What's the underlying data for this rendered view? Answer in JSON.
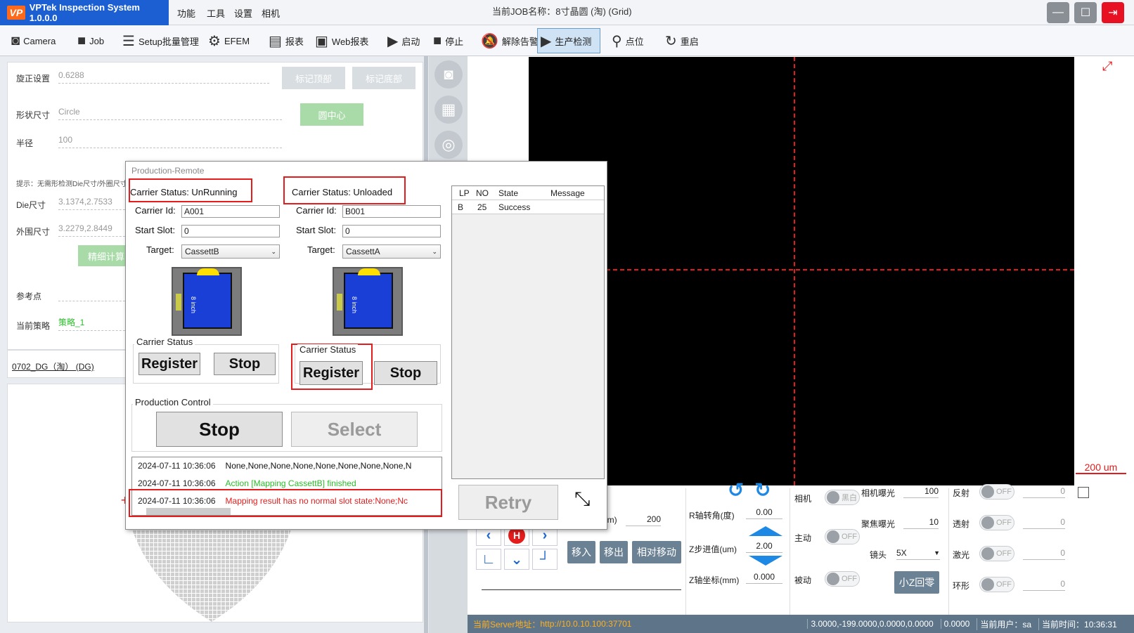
{
  "app": {
    "title": "VPTek Inspection System 1.0.0.0",
    "logo": "VP",
    "job_title": "当前JOB名称：8寸晶圆  (淘)  (Grid)"
  },
  "menu": [
    "功能",
    "工具",
    "设置",
    "相机"
  ],
  "window": {
    "minimize": "—",
    "maximize": "☐",
    "exit": "⇥"
  },
  "toolbar": [
    {
      "label": "Camera",
      "icon": "camera-icon"
    },
    {
      "label": "Job",
      "icon": "briefcase-icon"
    },
    {
      "label": "Setup批量管理",
      "icon": "list-icon"
    },
    {
      "label": "EFEM",
      "icon": "robot-arm-icon"
    },
    {
      "label": "报表",
      "icon": "report-icon"
    },
    {
      "label": "Web报表",
      "icon": "web-report-icon"
    },
    {
      "label": "启动",
      "icon": "play-icon"
    },
    {
      "label": "停止",
      "icon": "stop-icon"
    },
    {
      "label": "解除告警",
      "icon": "bell-off-icon"
    },
    {
      "label": "生产检测",
      "icon": "play-icon"
    },
    {
      "label": "点位",
      "icon": "location-pin-icon"
    },
    {
      "label": "重启",
      "icon": "refresh-icon"
    }
  ],
  "left": {
    "rotation_label": "旋正设置",
    "rotation_value": "0.6288",
    "mark_top": "标记顶部",
    "mark_bottom": "标记底部",
    "shape_label": "形状尺寸",
    "shape_value": "Circle",
    "circle_center": "圆中心",
    "radius_label": "半径",
    "radius_value": "100",
    "hint": "提示：无需形检测Die尺寸/外圈尺寸",
    "die_label": "Die尺寸",
    "die_value": "3.1374,2.7533",
    "outer_label": "外围尺寸",
    "outer_value": "3.2279,2.8449",
    "refine_btn": "精细计算",
    "ref_label": "参考点",
    "strategy_label": "当前策略",
    "strategy_value": "策略_1",
    "job_link": "0702_DG（淘） (DG)"
  },
  "image": {
    "scale": "200 um"
  },
  "bottom": {
    "um_label": "um)",
    "um_value": "200",
    "r_label": "R轴转角(度)",
    "r_value": "0.00",
    "zstep_label": "Z步进值(um)",
    "zstep_value": "2.00",
    "zcoord_label": "Z轴坐标(mm)",
    "zcoord_value": "0.000",
    "move_in": "移入",
    "move_out": "移出",
    "rel_move": "相对移动",
    "camera_label": "相机",
    "camera_toggle": "黑白",
    "active_label": "主动",
    "passive_label": "被动",
    "off": "OFF",
    "cam_exposure_label": "相机曝光",
    "cam_exposure_value": "100",
    "focus_exposure_label": "聚焦曝光",
    "focus_exposure_value": "10",
    "lens_label": "镜头",
    "lens_value": "5X",
    "small_z_home": "小Z回零",
    "reflect_label": "反射",
    "transmit_label": "透射",
    "laser_label": "激光",
    "ring_label": "环形",
    "light_values": [
      "0",
      "0",
      "0",
      "0"
    ],
    "home_icon": "H"
  },
  "status": {
    "server_label": "当前Server地址：",
    "server_url": "http://10.0.10.100:37701",
    "coords": "3.0000,-199.0000,0.0000,0.0000",
    "value2": "0.0000",
    "user": "当前用户：sa",
    "time": "当前时间：10:36:31"
  },
  "dialog": {
    "title": "Production-Remote",
    "left": {
      "status": "Carrier Status:  UnRunning",
      "carrier_id_label": "Carrier Id:",
      "carrier_id": "A001",
      "start_slot_label": "Start Slot:",
      "start_slot": "0",
      "target_label": "Target:",
      "target": "CassettB",
      "wafer_text": "8 inch",
      "group": "Carrier Status",
      "register": "Register",
      "stop": "Stop"
    },
    "right": {
      "status": "Carrier Status:  Unloaded",
      "carrier_id_label": "Carrier Id:",
      "carrier_id": "B001",
      "start_slot_label": "Start Slot:",
      "start_slot": "0",
      "target_label": "Target:",
      "target": "CassettA",
      "wafer_text": "8 inch",
      "group": "Carrier Status",
      "register": "Register",
      "stop": "Stop"
    },
    "production_control": "Production Control",
    "stop": "Stop",
    "select": "Select",
    "table": {
      "headers": [
        "LP",
        "NO",
        "State",
        "Message"
      ],
      "rows": [
        [
          "B",
          "25",
          "Success",
          ""
        ]
      ]
    },
    "retry": "Retry",
    "log": [
      {
        "time": "2024-07-11 10:36:06",
        "msg": "None,None,None,None,None,None,None,None,N",
        "color": "#111"
      },
      {
        "time": "2024-07-11 10:36:06",
        "msg": "Action [Mapping CassettB] finished",
        "color": "#2bbd2b"
      },
      {
        "time": "2024-07-11 10:36:06",
        "msg": "Mapping result has no normal slot state:None;Nc",
        "color": "#e41c1c"
      }
    ]
  }
}
